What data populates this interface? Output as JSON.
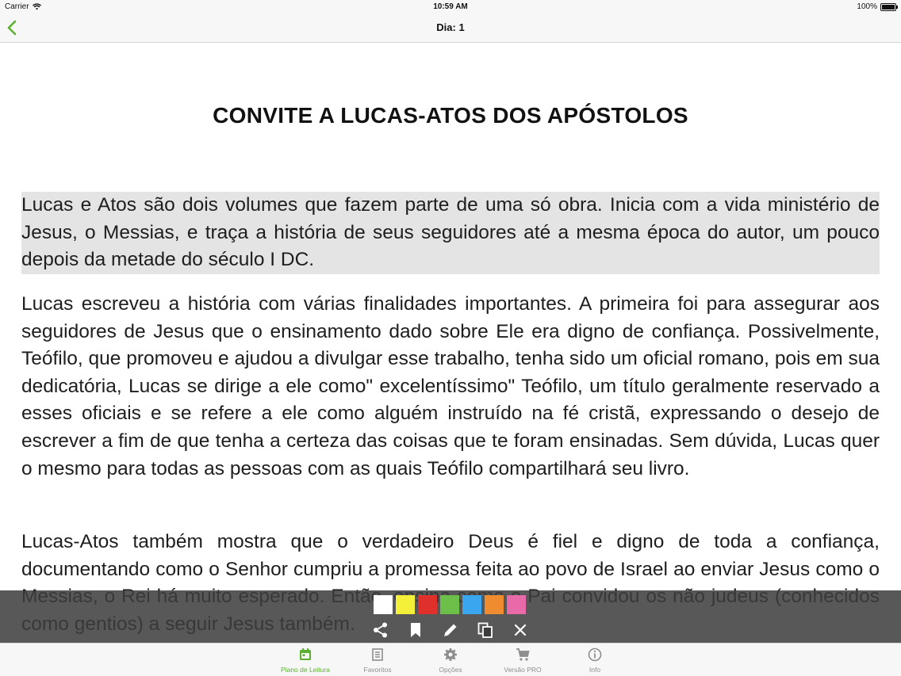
{
  "status_bar": {
    "carrier": "Carrier",
    "time": "10:59 AM",
    "battery": "100%",
    "battery_level": 1.0
  },
  "nav": {
    "title": "Dia: 1",
    "back_icon": "chevron-left-icon"
  },
  "document": {
    "title": "CONVITE A LUCAS-ATOS DOS APÓSTOLOS",
    "paragraphs": [
      "Lucas e Atos são dois volumes que fazem parte de uma só obra. Inicia com a vida ministério de Jesus, o Messias, e traça a história de seus seguidores até a mesma época do autor, um pouco depois da metade do século I DC.",
      "Lucas escreveu a história com várias finalidades importantes. A primeira foi para assegurar aos seguidores de Jesus que o ensinamento dado sobre Ele era digno de confiança. Possivelmente, Teófilo, que promoveu e ajudou a divulgar esse trabalho, tenha sido um oficial romano, pois em sua dedicatória, Lucas se dirige a ele como\" excelentíssimo\" Teófilo, um título geralmente reservado a esses oficiais e se refere a ele como alguém instruído na fé cristã, expressando o desejo de escrever a fim de que tenha a certeza das coisas que te foram ensinadas. Sem dúvida, Lucas quer o mesmo para todas as pessoas com as quais Teófilo compartilhará seu livro.",
      "Lucas-Atos também mostra que o verdadeiro Deus é fiel e digno de toda a confiança, documentando como o Senhor cumpriu a promessa feita ao povo de Israel ao enviar Jesus como o Messias, o Rei há muito esperado. Então, ensina como o Pai convidou os não judeus (conhecidos como gentios) a seguir Jesus também."
    ],
    "selected_paragraph_index": 0
  },
  "highlight_toolbar": {
    "colors": [
      "#ffffff",
      "#f4f03a",
      "#e0302c",
      "#6cc04a",
      "#3aa6f0",
      "#f08c30",
      "#e86aa8"
    ],
    "actions": [
      "share-icon",
      "bookmark-icon",
      "pencil-icon",
      "copy-icon",
      "close-icon"
    ]
  },
  "tabs": [
    {
      "label": "Plano de Leitura",
      "icon": "calendar-icon",
      "active": true
    },
    {
      "label": "Favoritos",
      "icon": "book-icon",
      "active": false
    },
    {
      "label": "Opções",
      "icon": "gear-icon",
      "active": false
    },
    {
      "label": "Versão PRO",
      "icon": "cart-icon",
      "active": false
    },
    {
      "label": "Info",
      "icon": "info-icon",
      "active": false
    }
  ],
  "colors": {
    "accent": "#5cb030",
    "toolbar_bg": "#3c3c3c",
    "selection": "#e4e4e4"
  }
}
